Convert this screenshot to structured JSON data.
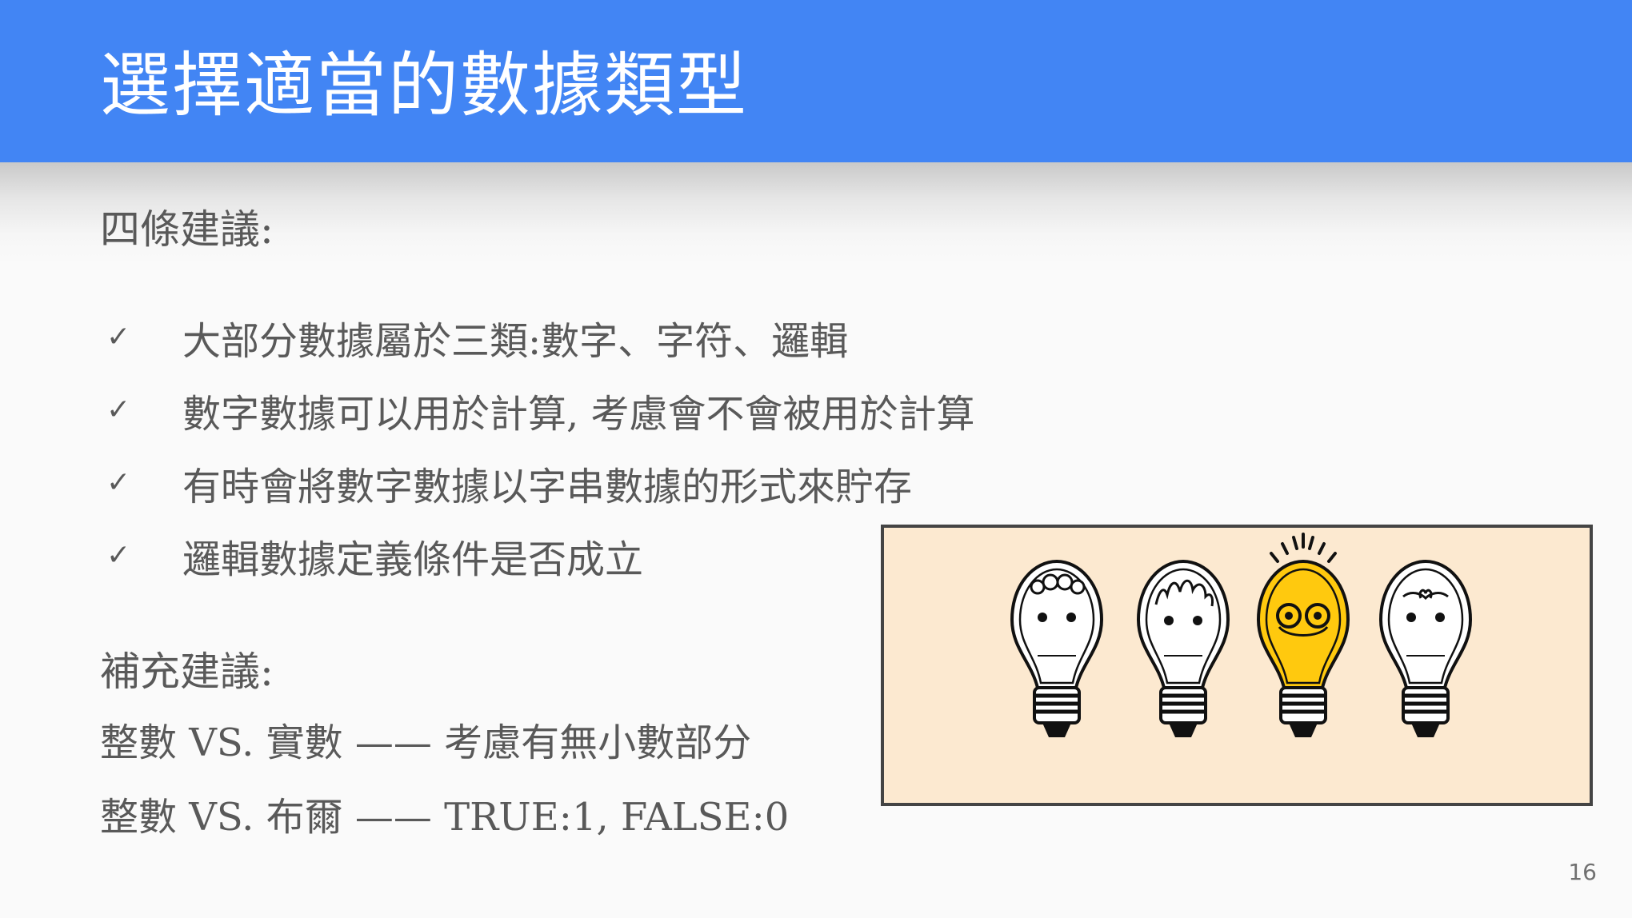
{
  "slide": {
    "title": "選擇適當的數據類型",
    "subtitle": "四條建議:",
    "bullets": [
      {
        "icon": "checkmark-icon",
        "text": "大部分數據屬於三類:數字、字符、邏輯"
      },
      {
        "icon": "checkmark-icon",
        "text": "數字數據可以用於計算, 考慮會不會被用於計算"
      },
      {
        "icon": "checkmark-icon",
        "text": "有時會將數字數據以字串數據的形式來貯存"
      },
      {
        "icon": "checkmark-icon",
        "text": "邏輯數據定義條件是否成立"
      }
    ],
    "supplement": {
      "heading": "補充建議:",
      "lines": [
        "整數 VS. 實數 —— 考慮有無小數部分",
        "整數 VS. 布爾 —— TRUE:1, FALSE:0"
      ]
    },
    "illustration": {
      "name": "light-bulbs-illustration",
      "bulb_count": 4,
      "highlighted_bulb": 3,
      "background_color": "#fce9d0",
      "highlight_color": "#ffc90e"
    },
    "page_number": "16"
  },
  "colors": {
    "header": "#4285f4",
    "text": "#595959",
    "background": "#fafafa"
  }
}
